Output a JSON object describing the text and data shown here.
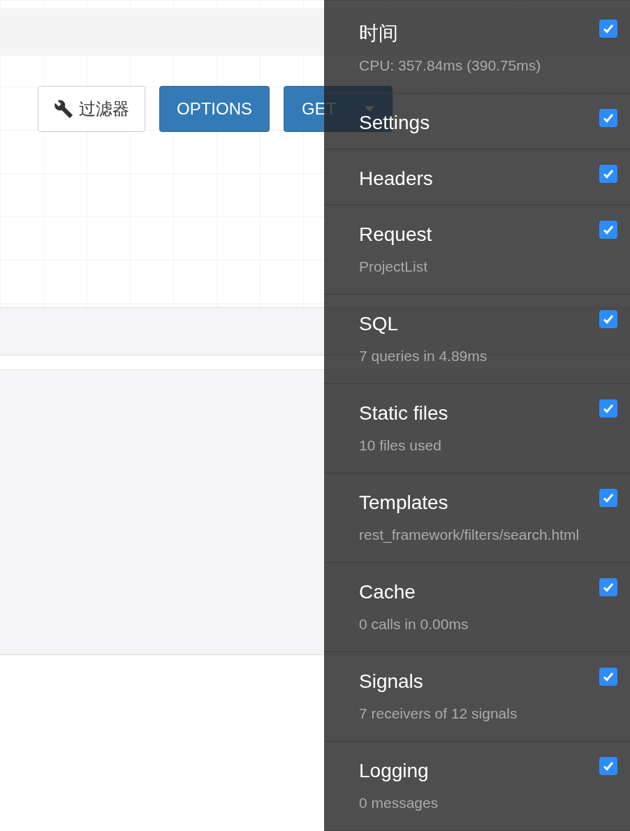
{
  "buttons": [
    {
      "kind": "filter",
      "label": "过滤器"
    },
    {
      "kind": "primary",
      "label": "OPTIONS"
    },
    {
      "kind": "dropdown",
      "label": "GET"
    }
  ],
  "debug_panels": [
    {
      "title": "时间",
      "subtitle": "CPU: 357.84ms (390.75ms)",
      "checked": true
    },
    {
      "title": "Settings",
      "checked": true
    },
    {
      "title": "Headers",
      "checked": true
    },
    {
      "title": "Request",
      "subtitle": "ProjectList",
      "checked": true
    },
    {
      "title": "SQL",
      "subtitle": "7 queries in 4.89ms",
      "checked": true
    },
    {
      "title": "Static files",
      "subtitle": "10 files used",
      "checked": true
    },
    {
      "title": "Templates",
      "subtitle": "rest_framework/filters/search.html",
      "checked": true
    },
    {
      "title": "Cache",
      "subtitle": "0 calls in 0.00ms",
      "checked": true
    },
    {
      "title": "Signals",
      "subtitle": "7 receivers of 12 signals",
      "checked": true
    },
    {
      "title": "Logging",
      "subtitle": "0 messages",
      "checked": true
    }
  ]
}
